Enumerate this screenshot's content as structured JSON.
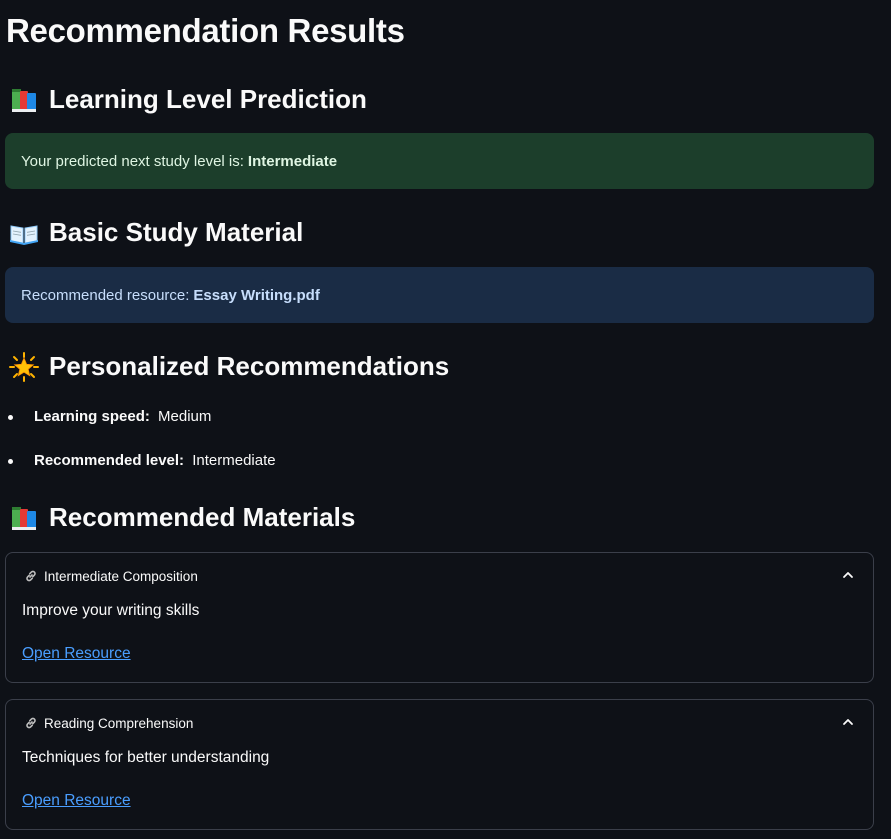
{
  "page_title": "Recommendation Results",
  "sections": {
    "prediction": {
      "icon": "books-icon",
      "heading": "Learning Level Prediction",
      "alert_text": "Your predicted next study level is:",
      "alert_value": "Intermediate"
    },
    "basic_material": {
      "icon": "open-book-icon",
      "heading": "Basic Study Material",
      "alert_text": "Recommended resource:",
      "alert_value": "Essay Writing.pdf"
    },
    "personalized": {
      "icon": "glowing-star-icon",
      "heading": "Personalized Recommendations",
      "items": [
        {
          "label": "Learning speed:",
          "value": "Medium"
        },
        {
          "label": "Recommended level:",
          "value": "Intermediate"
        }
      ]
    },
    "materials": {
      "icon": "books-icon",
      "heading": "Recommended Materials",
      "items": [
        {
          "title": "Intermediate Composition",
          "description": "Improve your writing skills",
          "link_text": "Open Resource"
        },
        {
          "title": "Reading Comprehension",
          "description": "Techniques for better understanding",
          "link_text": "Open Resource"
        }
      ]
    }
  },
  "colors": {
    "background": "#0e1117",
    "success_bg": "#1c3e2b",
    "info_bg": "#1a2c45",
    "link": "#4a9eff",
    "border": "#3b3f4a"
  }
}
